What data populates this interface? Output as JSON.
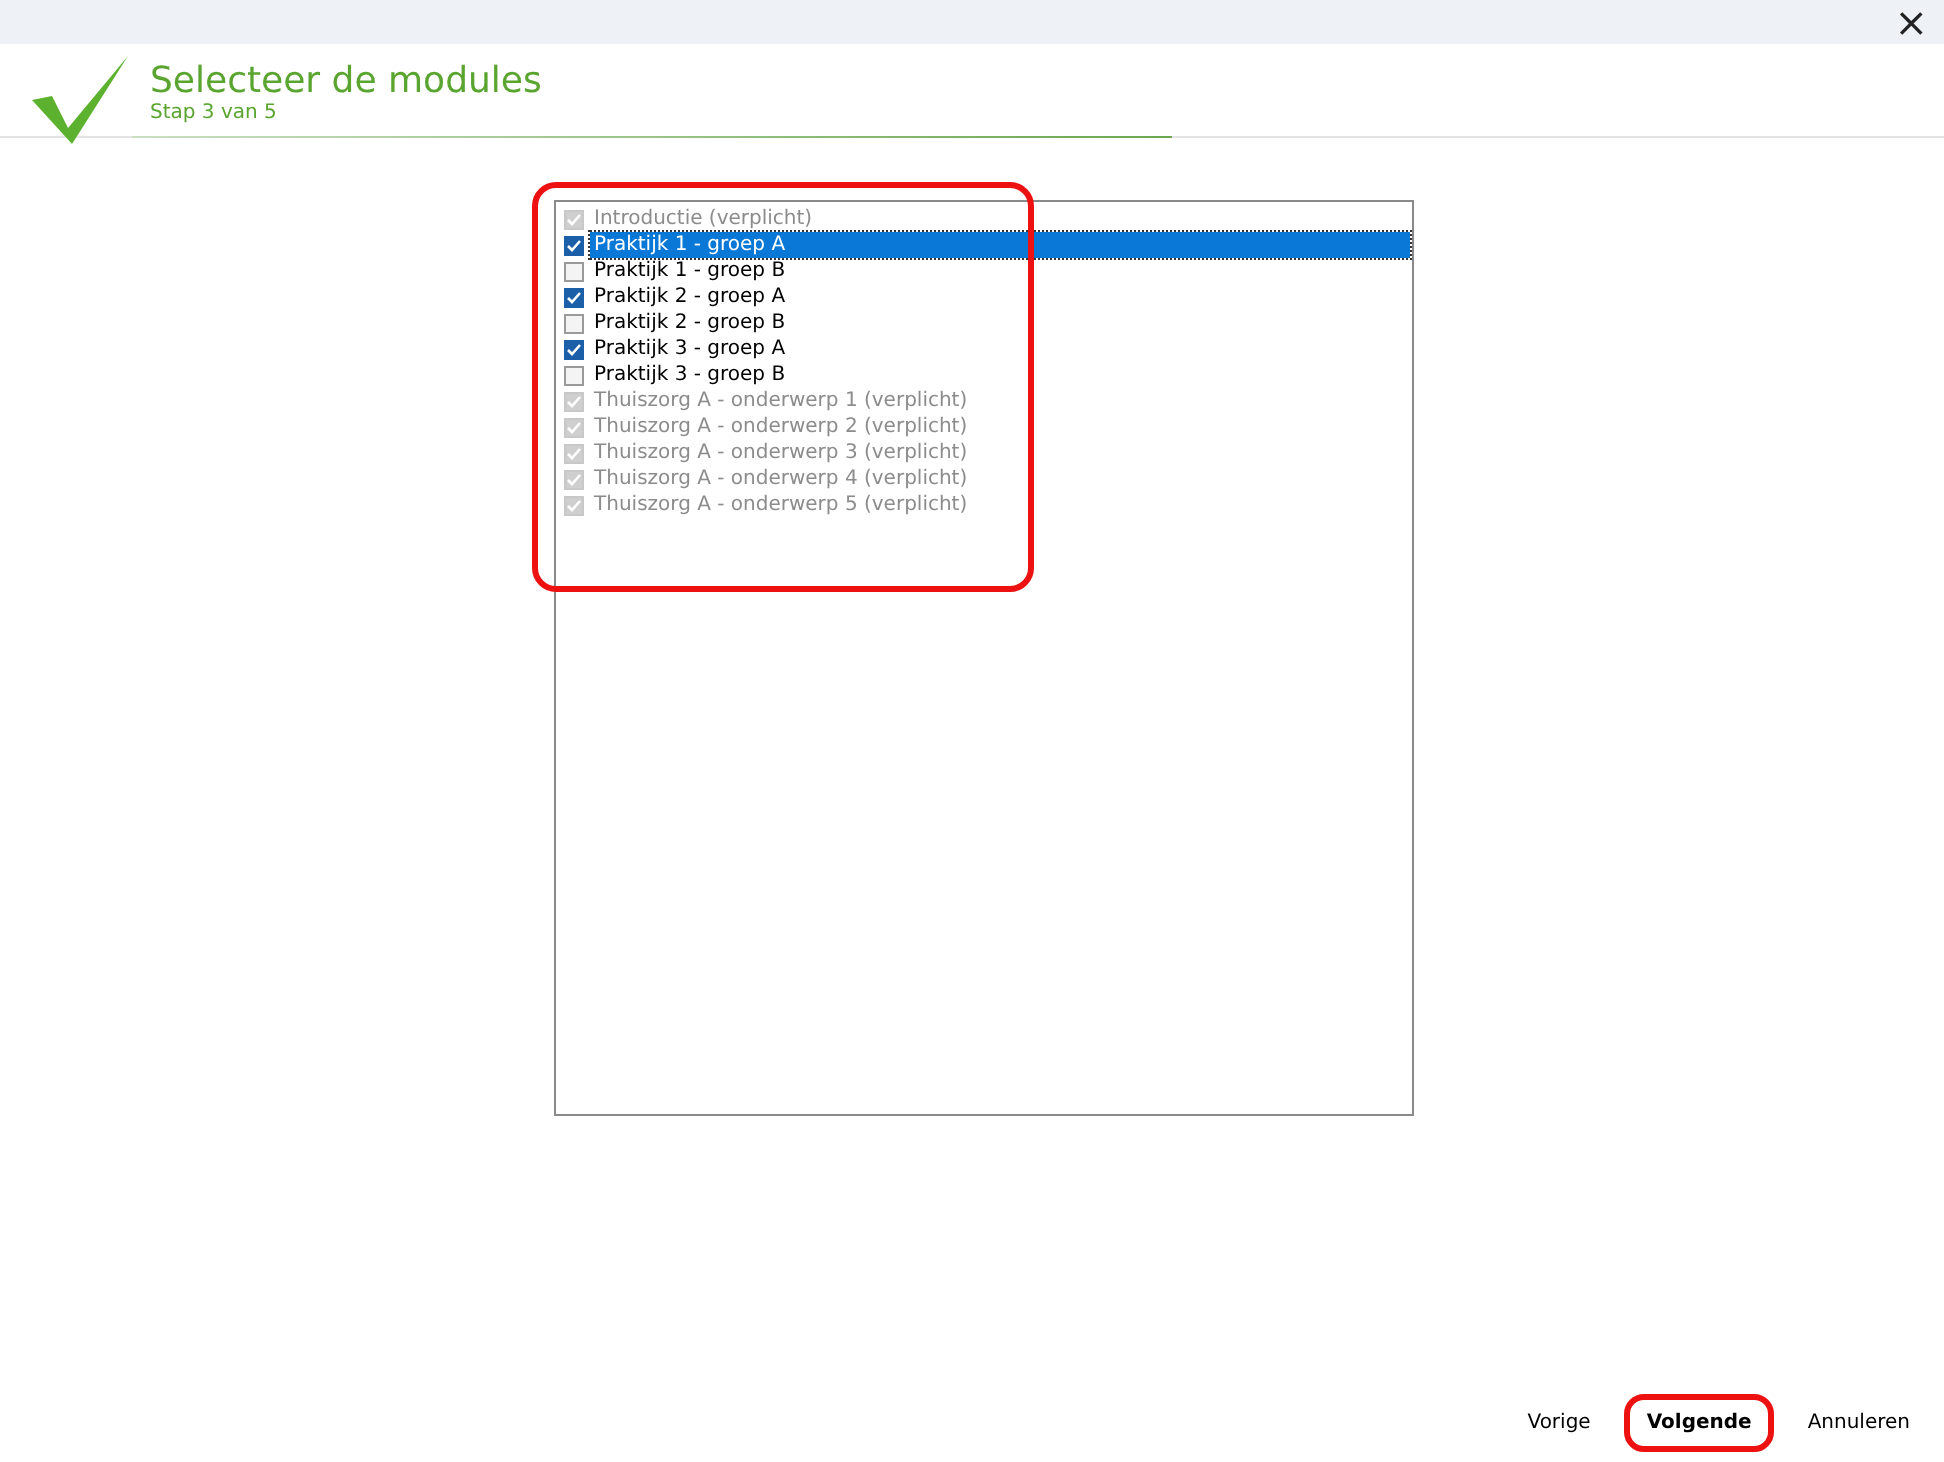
{
  "window": {
    "close": "×"
  },
  "header": {
    "title": "Selecteer de modules",
    "subtitle": "Stap 3 van 5"
  },
  "module_list": {
    "highlighted": true,
    "items": [
      {
        "label": "Introductie (verplicht)",
        "checked": true,
        "disabled": true,
        "selected": false
      },
      {
        "label": "Praktijk 1 - groep A",
        "checked": true,
        "disabled": false,
        "selected": true
      },
      {
        "label": "Praktijk 1 - groep B",
        "checked": false,
        "disabled": false,
        "selected": false
      },
      {
        "label": "Praktijk 2 - groep A",
        "checked": true,
        "disabled": false,
        "selected": false
      },
      {
        "label": "Praktijk 2 - groep B",
        "checked": false,
        "disabled": false,
        "selected": false
      },
      {
        "label": "Praktijk 3 - groep A",
        "checked": true,
        "disabled": false,
        "selected": false
      },
      {
        "label": "Praktijk 3 - groep B",
        "checked": false,
        "disabled": false,
        "selected": false
      },
      {
        "label": "Thuiszorg A - onderwerp 1 (verplicht)",
        "checked": true,
        "disabled": true,
        "selected": false
      },
      {
        "label": "Thuiszorg A - onderwerp 2 (verplicht)",
        "checked": true,
        "disabled": true,
        "selected": false
      },
      {
        "label": "Thuiszorg A - onderwerp 3 (verplicht)",
        "checked": true,
        "disabled": true,
        "selected": false
      },
      {
        "label": "Thuiszorg A - onderwerp 4 (verplicht)",
        "checked": true,
        "disabled": true,
        "selected": false
      },
      {
        "label": "Thuiszorg A - onderwerp 5 (verplicht)",
        "checked": true,
        "disabled": true,
        "selected": false
      }
    ]
  },
  "buttons": [
    {
      "label": "Vorige",
      "default": false,
      "highlighted": false
    },
    {
      "label": "Volgende",
      "default": true,
      "highlighted": true
    },
    {
      "label": "Annuleren",
      "default": false,
      "highlighted": false
    }
  ]
}
